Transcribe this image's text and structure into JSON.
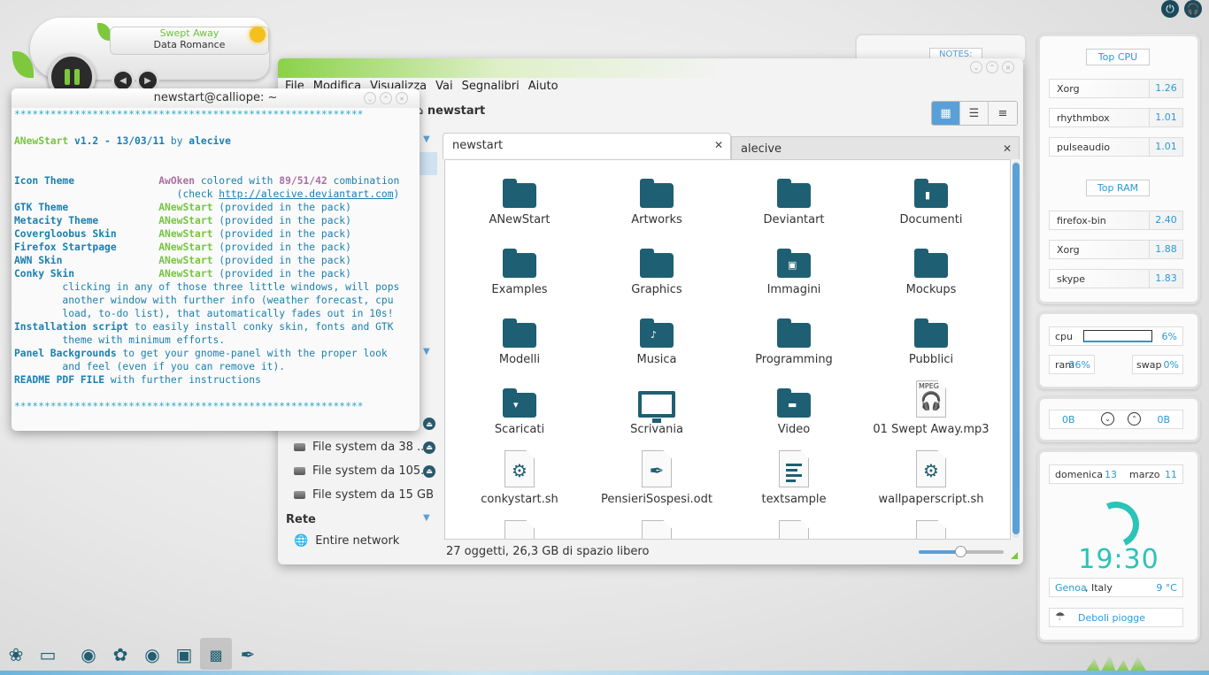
{
  "colors": {
    "accent": "#2a9ad6",
    "folder": "#1f5f73",
    "green": "#76c442",
    "selected": "#5aa0d8"
  },
  "player": {
    "track_title": "Swept Away",
    "track_album": "Data Romance",
    "icons": [
      "pause-icon",
      "prev-icon",
      "next-icon"
    ]
  },
  "filemanager": {
    "menu": [
      "File",
      "Modifica",
      "Visualizza",
      "Vai",
      "Segnalibri",
      "Aiuto"
    ],
    "breadcrumb": "newstart",
    "tabs": [
      {
        "label": "newstart",
        "active": true
      },
      {
        "label": "alecive",
        "active": false
      }
    ],
    "sidebar": {
      "drives": [
        {
          "label": "File system da 38 ..."
        },
        {
          "label": "File system da 105..."
        },
        {
          "label": "File system da 15 GB"
        }
      ],
      "network_header": "Rete",
      "network_item": "Entire network"
    },
    "files": [
      {
        "name": "ANewStart",
        "icon": "folder"
      },
      {
        "name": "Artworks",
        "icon": "folder"
      },
      {
        "name": "Deviantart",
        "icon": "folder"
      },
      {
        "name": "Documenti",
        "icon": "folder-documents"
      },
      {
        "name": "Examples",
        "icon": "folder"
      },
      {
        "name": "Graphics",
        "icon": "folder"
      },
      {
        "name": "Immagini",
        "icon": "folder-pictures"
      },
      {
        "name": "Mockups",
        "icon": "folder"
      },
      {
        "name": "Modelli",
        "icon": "folder"
      },
      {
        "name": "Musica",
        "icon": "folder-music"
      },
      {
        "name": "Programming",
        "icon": "folder"
      },
      {
        "name": "Pubblici",
        "icon": "folder"
      },
      {
        "name": "Scaricati",
        "icon": "folder-download"
      },
      {
        "name": "Scrivania",
        "icon": "desktop"
      },
      {
        "name": "Video",
        "icon": "folder-video"
      },
      {
        "name": "01 Swept Away.mp3",
        "icon": "audio-file",
        "badge": "MPEG"
      },
      {
        "name": "conkystart.sh",
        "icon": "script-file"
      },
      {
        "name": "PensieriSospesi.odt",
        "icon": "document-file"
      },
      {
        "name": "textsample",
        "icon": "text-file"
      },
      {
        "name": "wallpaperscript.sh",
        "icon": "script-file"
      }
    ],
    "status": "27 oggetti, 26,3 GB di spazio libero",
    "zoom_level": 0.48
  },
  "notes": {
    "label": "NOTES:"
  },
  "terminal": {
    "title": "newstart@calliope: ~",
    "stars": "**********************************************************",
    "name": "ANewStart",
    "version": "v1.2 - 13/03/11",
    "by": "by",
    "author": "alecive",
    "icon_theme_label": "Icon Theme",
    "icon_theme_value": "AwOken",
    "colored_with": "colored with",
    "combination_value": "89/51/42",
    "combination": "combination",
    "check_open": "(check",
    "check_url": "http://alecive.deviantart.com",
    "check_close": ")",
    "rows": [
      {
        "label": "GTK Theme",
        "value": "ANewStart"
      },
      {
        "label": "Metacity Theme",
        "value": "ANewStart"
      },
      {
        "label": "Covergloobus Skin",
        "value": "ANewStart"
      },
      {
        "label": "Firefox Startpage",
        "value": "ANewStart"
      },
      {
        "label": "AWN Skin",
        "value": "ANewStart"
      },
      {
        "label": "Conky Skin",
        "value": "ANewStart"
      }
    ],
    "provided": "(provided in the pack)",
    "conky_note_1": "clicking in any of those three little windows, will pops",
    "conky_note_2": "another window with further info (weather forecast, cpu",
    "conky_note_3": "load, to-do list), that automatically fades out in 10s!",
    "install_label": "Installation script",
    "install_1": "to easily install conky skin, fonts and GTK",
    "install_2": "theme with minimum efforts.",
    "panel_label": "Panel Backgrounds",
    "panel_1": "to get your gnome-panel with the proper look",
    "panel_2": "and feel (even if you can remove it).",
    "readme_label": "README PDF FILE",
    "readme_text": "with further instructions",
    "prompt": "_"
  },
  "conky": {
    "top_cpu_label": "Top CPU",
    "top_cpu": [
      {
        "name": "Xorg",
        "value": "1.26"
      },
      {
        "name": "rhythmbox",
        "value": "1.01"
      },
      {
        "name": "pulseaudio",
        "value": "1.01"
      }
    ],
    "top_ram_label": "Top RAM",
    "top_ram": [
      {
        "name": "firefox-bin",
        "value": "2.40"
      },
      {
        "name": "Xorg",
        "value": "1.88"
      },
      {
        "name": "skype",
        "value": "1.83"
      }
    ],
    "cpu_label": "cpu",
    "cpu_value": "6%",
    "ram_label": "ram",
    "ram_value": "26%",
    "swap_label": "swap",
    "swap_value": "0%",
    "down_value": "0B",
    "up_value": "0B",
    "day_name": "domenica",
    "day": "13",
    "month": "marzo",
    "month_num": "11",
    "time": "19:30",
    "city": "Genoa",
    "country": ", Italy",
    "temp": "9 °C",
    "weather": "Deboli piogge"
  }
}
